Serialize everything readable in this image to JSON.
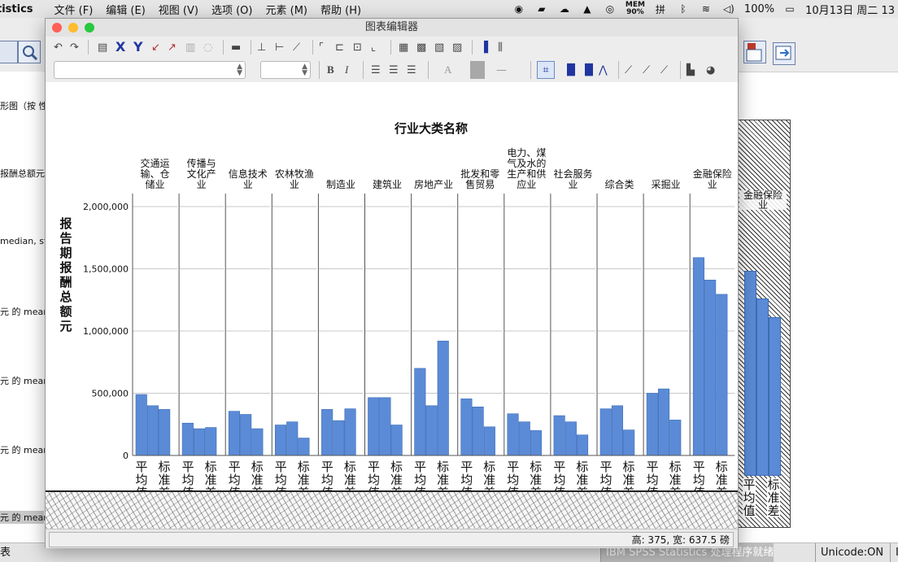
{
  "menubar": {
    "app": "tistics",
    "menus": [
      "文件 (F)",
      "编辑 (E)",
      "视图 (V)",
      "选项 (O)",
      "元素 (M)",
      "帮助 (H)"
    ],
    "mem_label": "MEM",
    "mem_value": "90%",
    "battery": "100%",
    "datetime": "10月13日 周二 13"
  },
  "background": {
    "outline_items": [
      "形图（按 性",
      "报酬总额元",
      "median, st",
      "元 的 mear",
      "元 的 mear",
      "元 的 mear",
      "元 的 mear"
    ],
    "hatched_panel": {
      "category": "金融保险业",
      "x_labels": [
        "平均值",
        "标准差"
      ],
      "values": [
        1280000,
        1110000,
        990000
      ]
    },
    "status": {
      "left": "表",
      "processor": "IBM SPSS Statistics 处理程序就绪",
      "unicode": "Unicode:ON",
      "extra": "I"
    }
  },
  "editor": {
    "title": "图表编辑器",
    "font_size_value": "",
    "format_buttons": {
      "bold": "B",
      "italic": "I",
      "font_color": "A"
    },
    "status_dimensions": "高: 375, 宽: 637.5 磅"
  },
  "chart_data": {
    "type": "bar",
    "title": "行业大类名称",
    "ylabel": "报告期报酬总额元",
    "ylim": [
      0,
      2000000
    ],
    "yticks": [
      0,
      500000,
      1000000,
      1500000,
      2000000
    ],
    "ytick_labels": [
      "0",
      "500,000",
      "1,000,000",
      "1,500,000",
      "2,000,000"
    ],
    "grid": true,
    "bar_color": "#5b8bd6",
    "x_labels": [
      "平均值",
      "标准差"
    ],
    "panels": [
      {
        "category": [
          "交通运",
          "输、仓",
          "储业"
        ],
        "values": [
          490000,
          400000,
          370000
        ]
      },
      {
        "category": [
          "传播与",
          "文化产",
          "业"
        ],
        "values": [
          260000,
          215000,
          225000
        ]
      },
      {
        "category": [
          "信息技术",
          "业"
        ],
        "values": [
          355000,
          330000,
          215000
        ]
      },
      {
        "category": [
          "农林牧渔",
          "业"
        ],
        "values": [
          245000,
          270000,
          140000
        ]
      },
      {
        "category": [
          "制造业"
        ],
        "values": [
          370000,
          280000,
          375000
        ]
      },
      {
        "category": [
          "建筑业"
        ],
        "values": [
          465000,
          465000,
          245000
        ]
      },
      {
        "category": [
          "房地产业"
        ],
        "values": [
          700000,
          400000,
          920000
        ]
      },
      {
        "category": [
          "批发和零",
          "售贸易"
        ],
        "values": [
          455000,
          390000,
          230000
        ]
      },
      {
        "category": [
          "电力、煤",
          "气及水的",
          "生产和供",
          "应业"
        ],
        "values": [
          335000,
          270000,
          200000
        ]
      },
      {
        "category": [
          "社会服务",
          "业"
        ],
        "values": [
          320000,
          270000,
          165000
        ]
      },
      {
        "category": [
          "综合类"
        ],
        "values": [
          375000,
          400000,
          205000
        ]
      },
      {
        "category": [
          "采掘业"
        ],
        "values": [
          500000,
          535000,
          285000
        ]
      },
      {
        "category": [
          "金融保险",
          "业"
        ],
        "values": [
          1590000,
          1410000,
          1295000
        ]
      }
    ]
  }
}
